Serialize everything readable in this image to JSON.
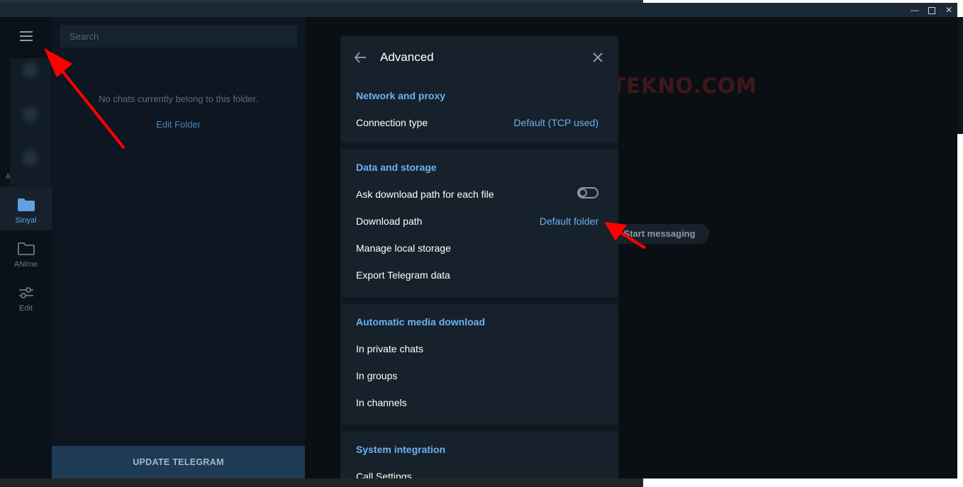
{
  "window": {
    "controls": {
      "minimize": "—",
      "close": "✕"
    }
  },
  "rail": {
    "stray_label": "A",
    "folders": [
      {
        "label": "Sinyal",
        "icon": "folder-filled-icon",
        "active": true
      },
      {
        "label": "ANime",
        "icon": "folder-outline-icon",
        "active": false
      },
      {
        "label": "Edit",
        "icon": "sliders-icon",
        "active": false
      }
    ]
  },
  "chatlist": {
    "search_placeholder": "Search",
    "empty_message": "No chats currently belong to this folder.",
    "edit_folder": "Edit Folder",
    "update_button": "UPDATE TELEGRAM"
  },
  "main": {
    "watermark": "EVOTEKNO.COM",
    "start_messaging": "Start messaging"
  },
  "dialog": {
    "title": "Advanced",
    "sections": [
      {
        "title": "Network and proxy",
        "rows": [
          {
            "label": "Connection type",
            "value": "Default (TCP used)"
          }
        ]
      },
      {
        "title": "Data and storage",
        "rows": [
          {
            "label": "Ask download path for each file",
            "toggle_on": false
          },
          {
            "label": "Download path",
            "value": "Default folder"
          },
          {
            "label": "Manage local storage"
          },
          {
            "label": "Export Telegram data"
          }
        ]
      },
      {
        "title": "Automatic media download",
        "rows": [
          {
            "label": "In private chats"
          },
          {
            "label": "In groups"
          },
          {
            "label": "In channels"
          }
        ]
      },
      {
        "title": "System integration",
        "rows": [
          {
            "label": "Call Settings"
          }
        ]
      }
    ]
  },
  "colors": {
    "accent": "#6ab3f3",
    "arrow": "#ff0000",
    "dialog_bg": "#17212b"
  }
}
